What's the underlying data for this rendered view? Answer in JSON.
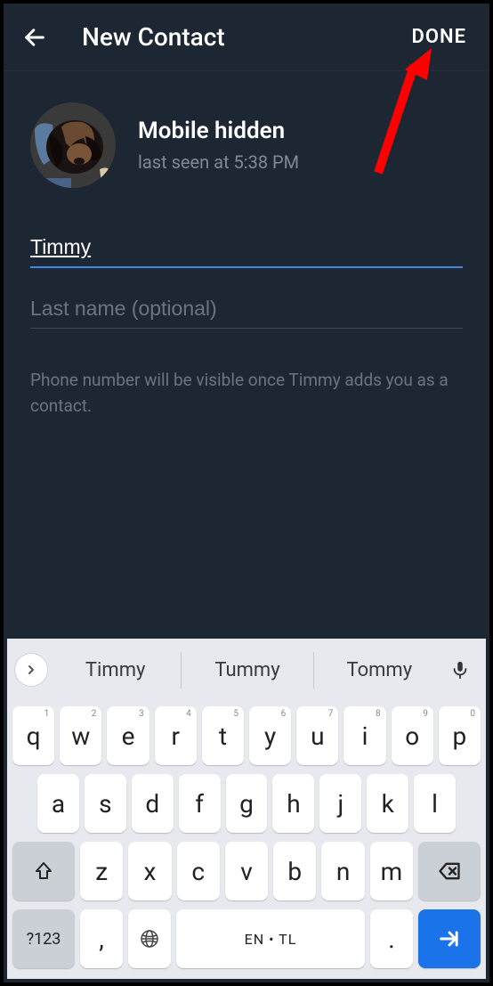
{
  "header": {
    "title": "New Contact",
    "done_label": "DONE"
  },
  "profile": {
    "name": "Mobile hidden",
    "status": "last seen at 5:38 PM"
  },
  "fields": {
    "first_name_value": "Timmy",
    "last_name_value": "",
    "last_name_placeholder": "Last name (optional)"
  },
  "note": "Phone number will be visible once Timmy adds you as a contact.",
  "keyboard": {
    "suggestions": [
      "Timmy",
      "Tummy",
      "Tommy"
    ],
    "row1": [
      {
        "k": "q",
        "h": "1"
      },
      {
        "k": "w",
        "h": "2"
      },
      {
        "k": "e",
        "h": "3"
      },
      {
        "k": "r",
        "h": "4"
      },
      {
        "k": "t",
        "h": "5"
      },
      {
        "k": "y",
        "h": "6"
      },
      {
        "k": "u",
        "h": "7"
      },
      {
        "k": "i",
        "h": "8"
      },
      {
        "k": "o",
        "h": "9"
      },
      {
        "k": "p",
        "h": "0"
      }
    ],
    "row2": [
      "a",
      "s",
      "d",
      "f",
      "g",
      "h",
      "j",
      "k",
      "l"
    ],
    "row3": [
      "z",
      "x",
      "c",
      "v",
      "b",
      "n",
      "m"
    ],
    "numeric_label": "?123",
    "space_label": "EN • TL",
    "comma": ",",
    "period": "."
  }
}
